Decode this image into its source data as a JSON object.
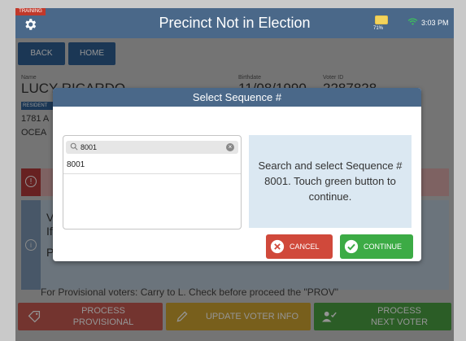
{
  "header": {
    "badge": "TRAINING",
    "title": "Precinct Not in Election",
    "battery_pct": "71%",
    "time": "3:03 PM"
  },
  "nav": {
    "back_label": "BACK",
    "home_label": "HOME"
  },
  "voter": {
    "name_label": "Name",
    "name": "LUCY RICARDO",
    "birthdate_label": "Birthdate",
    "birthdate": "11/08/1990",
    "voter_id_label": "Voter ID",
    "voter_id": "2287828",
    "resident_badge": "RESIDENT",
    "address_line1": "1781 A",
    "address_line2": "OCEA"
  },
  "info": {
    "line1": "V",
    "line2": "If",
    "line3": "P",
    "bottom_text": "For Provisional voters: Carry to L. Check before proceed the \"PROV\""
  },
  "actions": {
    "process_provisional": [
      "PROCESS",
      "PROVISIONAL"
    ],
    "update_voter_info": "UPDATE VOTER INFO",
    "process_next_voter": [
      "PROCESS",
      "NEXT VOTER"
    ]
  },
  "modal": {
    "title": "Select Sequence #",
    "search_value": "8001",
    "results": [
      "8001"
    ],
    "help_text": "Search and select Sequence # 8001. Touch green button to continue.",
    "cancel_label": "CANCEL",
    "continue_label": "CONTINUE"
  },
  "colors": {
    "header": "#4a6889",
    "nav_button": "#2f5f93",
    "cancel": "#d0493b",
    "continue": "#3cab45",
    "provisional": "#c65b52",
    "update": "#cfa431",
    "next_voter": "#4aa043"
  }
}
